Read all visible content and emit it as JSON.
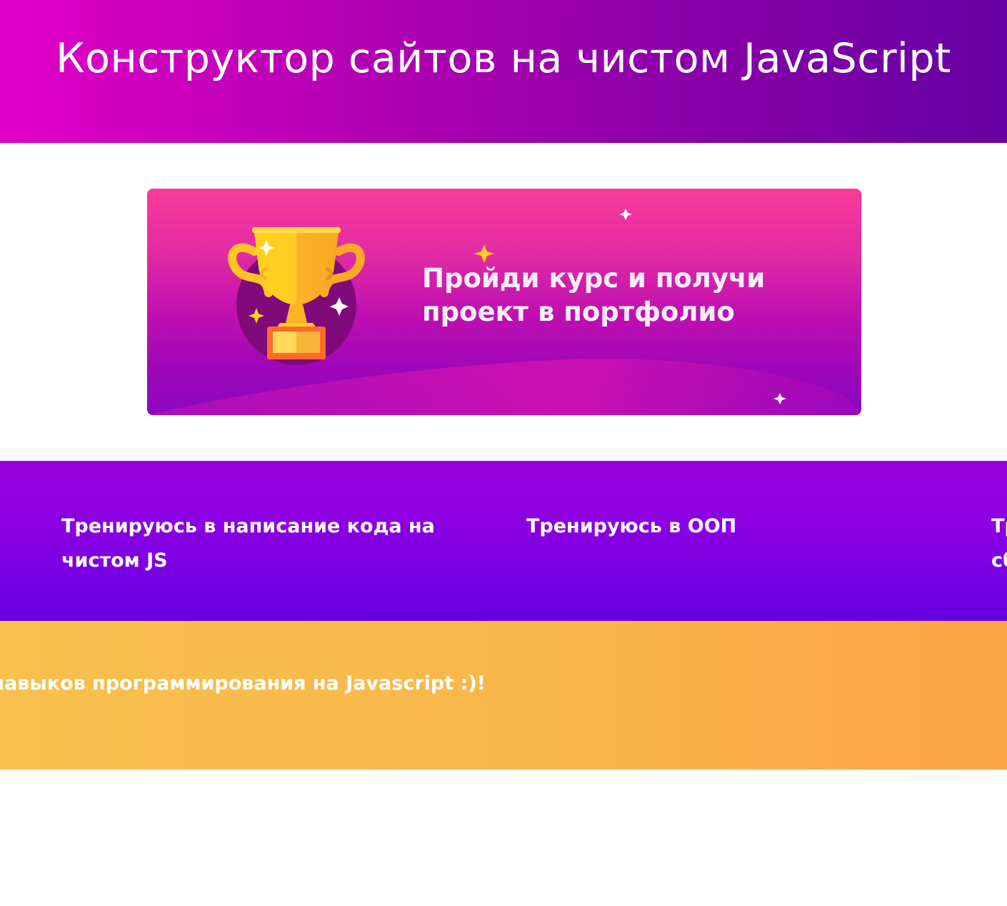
{
  "header": {
    "title": "Конструктор сайтов на чистом JavaScript"
  },
  "banner": {
    "line1": "Пройди курс и получи",
    "line2": "проект в портфолио",
    "image_icon": "trophy-icon"
  },
  "cards": [
    {
      "text": "Тренируюсь в написание кода на чистом JS"
    },
    {
      "text": "Тренируюсь в ООП"
    },
    {
      "text": "Тренируюсь в самостоятельной сборке"
    }
  ],
  "marquee": {
    "text": "Конструктор для тренировки навыков программирования на Javascript :)!"
  },
  "colors": {
    "header_start": "#e100c6",
    "header_end": "#6600a2",
    "cards_top": "#9c00e0",
    "cards_bottom": "#6600e0",
    "marquee_start": "#f8c04d",
    "marquee_end": "#fca348"
  }
}
